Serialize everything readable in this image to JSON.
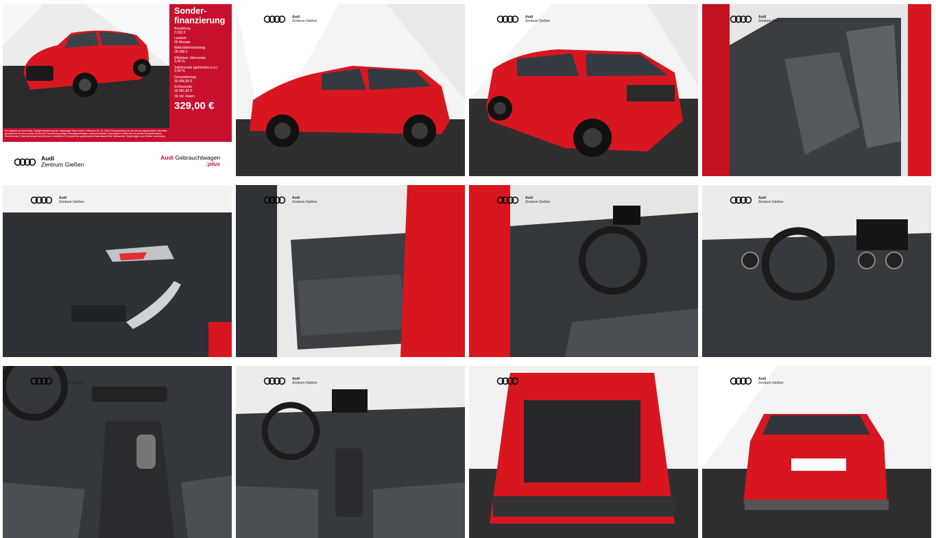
{
  "finance": {
    "title_line1": "Sonder-",
    "title_line2": "finanzierung",
    "rows": [
      {
        "label": "Anzahlung",
        "value": "2.262 €"
      },
      {
        "label": "Laufzeit",
        "value": "36 Monate"
      },
      {
        "label": "Nettodarlehnsbetrag",
        "value": "28.068 €"
      },
      {
        "label": "Effektiver Jahreszins",
        "value": "3,49 %"
      },
      {
        "label": "Sollzinssatz (gebunden p.a.)",
        "value": "3,44 %"
      },
      {
        "label": "Gesamtbetrag",
        "value": "30.496,85 €"
      },
      {
        "label": "Schlussrate",
        "value": "18.981,85 €"
      },
      {
        "label": "36 mtl. Raten",
        "value": ""
      }
    ],
    "price": "329,00 €",
    "disclaimer": "Ein Angebot der Audi Bank, Zweigniederlassung der Volkswagen Bank GmbH, Gifhorner Str. 57, 38112 Braunschweig, für die wir als ungebundener Vermittler gemeinsam mit dem Kunden die für die Finanzierung nötigen Vertragsunterlagen zusammenstellen. Das Angebot richtet sich an private und gewerbliche Einzelkunden. Zwischenverkauf und Irrtümer vorbehalten. Es besteht ein gesetzliches Widerrufsrecht für Verbraucher. Änderungen und Irrtümer vorbehalten.",
    "dealer_brand": "Audi",
    "dealer_name": "Zentrum Gießen",
    "used_car_brand": "Audi",
    "used_car_label": "Gebrauchtwagen",
    "used_car_plus": ":plus"
  },
  "watermark": {
    "brand": "Audi",
    "dealer": "Zentrum Gießen"
  },
  "colors": {
    "audi_red": "#c8102e",
    "car_red": "#d8161f",
    "interior_dark": "#2f3236"
  }
}
